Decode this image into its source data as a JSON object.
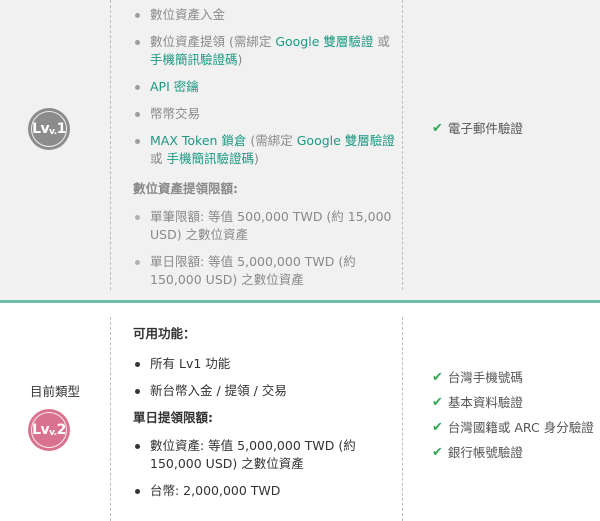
{
  "lv1": {
    "badge": {
      "main": "Lv",
      "num": "1",
      "color": "#8c8c8c"
    },
    "features": [
      {
        "parts": [
          {
            "t": "數位資產入金",
            "c": "muted"
          }
        ]
      },
      {
        "parts": [
          {
            "t": "數位資產提領 (需綁定 ",
            "c": "muted"
          },
          {
            "t": "Google 雙層驗證",
            "c": "link"
          },
          {
            "t": " 或 ",
            "c": "muted"
          },
          {
            "t": "手機簡訊驗證碼",
            "c": "link"
          },
          {
            "t": ")",
            "c": "muted"
          }
        ]
      },
      {
        "parts": [
          {
            "t": "API 密鑰",
            "c": "link"
          }
        ]
      },
      {
        "parts": [
          {
            "t": "幣幣交易",
            "c": "muted"
          }
        ]
      },
      {
        "parts": [
          {
            "t": "MAX Token 鎖倉",
            "c": "link"
          },
          {
            "t": " (需綁定 ",
            "c": "muted"
          },
          {
            "t": "Google 雙層驗證",
            "c": "link"
          },
          {
            "t": " 或 ",
            "c": "muted"
          },
          {
            "t": "手機簡訊驗證碼",
            "c": "link"
          },
          {
            "t": ")",
            "c": "muted"
          }
        ]
      }
    ],
    "limits_heading": "數位資產提領限額:",
    "limits": [
      {
        "parts": [
          {
            "t": "單筆限額: 等值 500,000 TWD (約 15,000 USD) 之數位資產",
            "c": "muted"
          }
        ]
      },
      {
        "parts": [
          {
            "t": "單日限額: 等值 5,000,000 TWD (約 150,000 USD) 之數位資產",
            "c": "muted"
          }
        ]
      }
    ],
    "requirements": [
      "電子郵件驗證"
    ]
  },
  "lv2": {
    "current_type_label": "目前類型",
    "badge": {
      "main": "Lv",
      "num": "2",
      "color": "#d9728f"
    },
    "features_heading": "可用功能：",
    "features": [
      {
        "parts": [
          {
            "t": "所有 Lv1 功能",
            "c": "dark"
          }
        ]
      },
      {
        "parts": [
          {
            "t": "新台幣入金 / 提領 / 交易",
            "c": "dark"
          }
        ]
      }
    ],
    "limits_heading": "單日提領限額:",
    "limits": [
      {
        "parts": [
          {
            "t": "數位資產: 等值 5,000,000 TWD (約 150,000 USD) 之數位資產",
            "c": "dark"
          }
        ]
      },
      {
        "parts": [
          {
            "t": "台幣: 2,000,000 TWD",
            "c": "dark"
          }
        ]
      }
    ],
    "requirements": [
      "台灣手機號碼",
      "基本資料驗證",
      "台灣國籍或 ARC 身分驗證",
      "銀行帳號驗證"
    ]
  },
  "colors": {
    "accent_link": "#1b9a83",
    "check": "#2eaa52",
    "separator": "#6dbdad"
  },
  "icons": {
    "requirement": "check-icon"
  }
}
